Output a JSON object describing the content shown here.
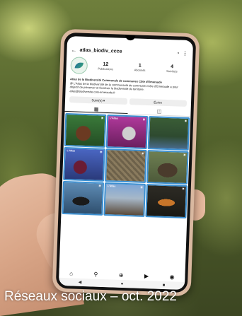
{
  "app": {
    "username": "atlas_biodiv_ccce",
    "back_icon": "arrow-left-icon",
    "notification_icon": "bell-icon",
    "menu_icon": "more-vertical-icon"
  },
  "profile": {
    "posts_count": "12",
    "posts_label": "Publications",
    "followers_count": "1",
    "followers_label": "Abonnés",
    "following_count": "4",
    "following_label": "Suivi(e)s",
    "name": "Atlas de la Biodiversité Communale de communes Côte d'Emeraude",
    "bio": "@ L'Atlas de la biodiversité de la communauté de communes Côte d'Emeraude a pour objectif de préserver et favoriser la biodiversité du territoire.",
    "link": "atlas@biodiversite.cote-emeraude.fr"
  },
  "buttons": {
    "follow_label": "Suivi(e) ▾",
    "message_label": "Écrire"
  },
  "tabs": {
    "grid_icon": "grid-icon",
    "tagged_icon": "tagged-person-icon"
  },
  "posts": [
    {
      "title": "",
      "badge": "▣"
    },
    {
      "title": "L'Atlas",
      "badge": "▣"
    },
    {
      "title": "",
      "badge": "▣"
    },
    {
      "title": "L'Atlas",
      "badge": "▣"
    },
    {
      "title": "",
      "badge": "▣"
    },
    {
      "title": "",
      "badge": "▣"
    },
    {
      "title": "",
      "badge": "▣"
    },
    {
      "title": "L'Atlas",
      "badge": "▣"
    },
    {
      "title": "",
      "badge": "▣"
    }
  ],
  "bottom_nav": [
    "home-icon",
    "search-icon",
    "add-post-icon",
    "reels-icon",
    "profile-icon"
  ],
  "system_nav": [
    "back-triangle-icon",
    "home-circle-icon",
    "recent-square-icon"
  ],
  "caption": "Réseaux sociaux – oct. 2022",
  "colors": {
    "post_border": "#3b8fd1",
    "caption_text": "#ffffff"
  }
}
